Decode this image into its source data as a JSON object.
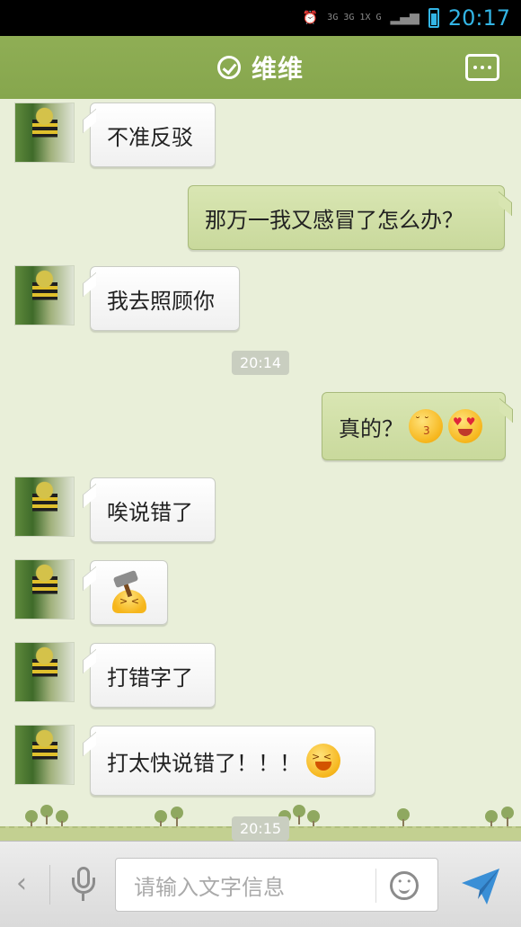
{
  "status_bar": {
    "network": "3G 3G 1X G",
    "time": "20:17"
  },
  "header": {
    "title": "维维"
  },
  "messages": [
    {
      "side": "left",
      "text": "不准反驳"
    },
    {
      "side": "right",
      "text": "那万一我又感冒了怎么办？"
    },
    {
      "side": "left",
      "text": "我去照顾你"
    },
    {
      "side": "right",
      "text": "真的？",
      "emojis": [
        "kiss-emoji",
        "heart-eyes-emoji"
      ]
    },
    {
      "side": "left",
      "text": "唉说错了"
    },
    {
      "side": "left",
      "text": "",
      "emojis": [
        "hammer-emoji"
      ]
    },
    {
      "side": "left",
      "text": "打错字了"
    },
    {
      "side": "left",
      "text": "打太快说错了！！！",
      "emojis": [
        "laugh-emoji"
      ]
    }
  ],
  "timestamps": [
    "20:14",
    "20:15"
  ],
  "input_bar": {
    "placeholder": "请输入文字信息"
  },
  "colors": {
    "header": "#8fae55",
    "chat_background": "#e9efd9",
    "outgoing_bubble": "#d3e1a9",
    "incoming_bubble": "#ffffff",
    "status_time": "#33b5e5"
  }
}
